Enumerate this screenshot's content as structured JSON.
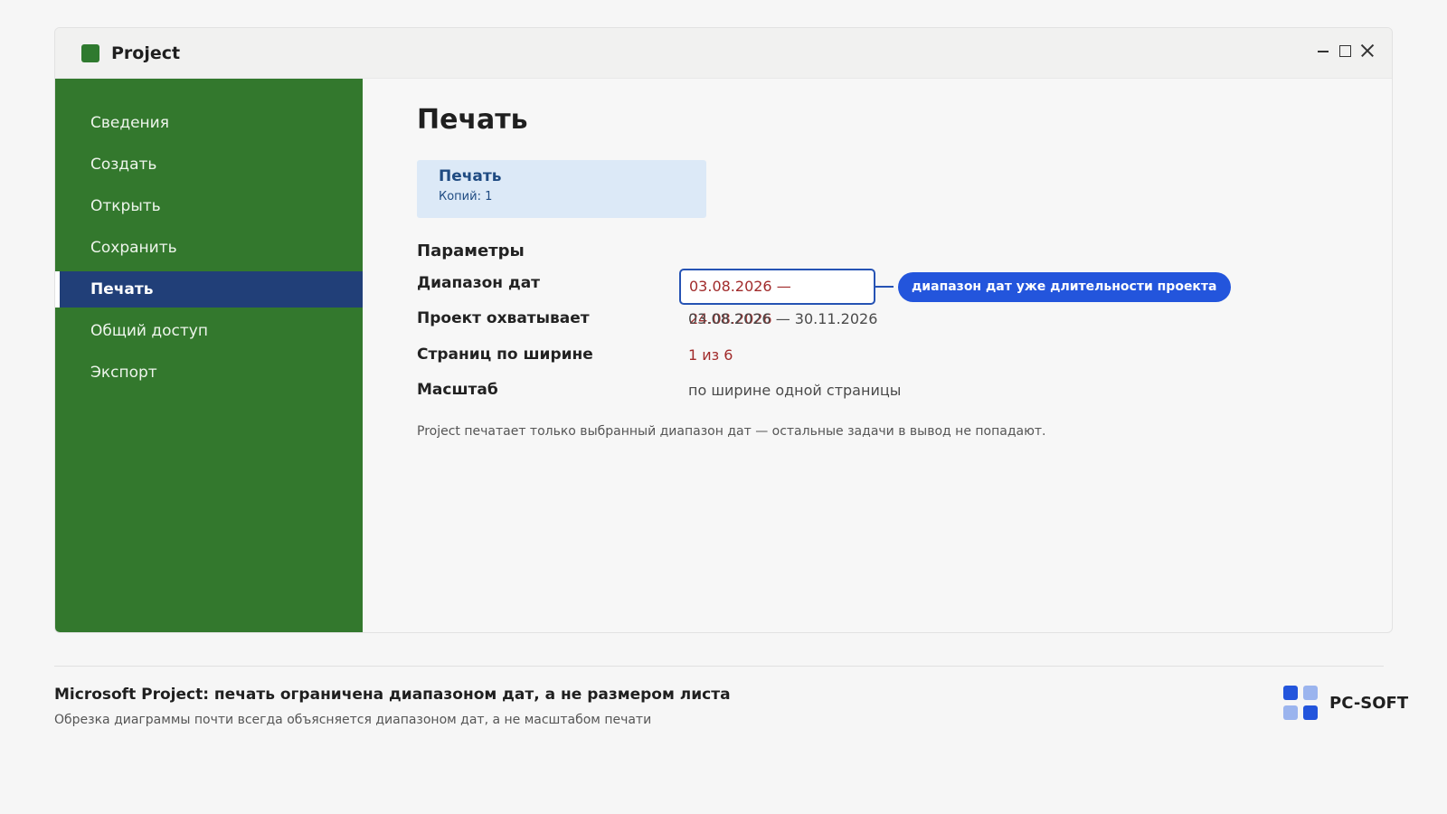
{
  "window": {
    "title": "Project",
    "icon": "project-app-icon",
    "accent": "#33782d"
  },
  "sidebar": {
    "items": [
      {
        "label": "Сведения"
      },
      {
        "label": "Создать"
      },
      {
        "label": "Открыть"
      },
      {
        "label": "Сохранить"
      },
      {
        "label": "Печать",
        "active": true
      },
      {
        "label": "Общий доступ"
      },
      {
        "label": "Экспорт"
      }
    ]
  },
  "main": {
    "title": "Печать",
    "print_button": {
      "label": "Печать",
      "copies": "Копий: 1"
    },
    "params_title": "Параметры",
    "rows": {
      "date_range": {
        "label": "Диапазон дат",
        "value": "03.08.2026 — 24.08.2026"
      },
      "project_span": {
        "label": "Проект охватывает",
        "value": "03.08.2026 — 30.11.2026"
      },
      "pages_wide": {
        "label": "Страниц по ширине",
        "value": "1 из 6"
      },
      "scale": {
        "label": "Масштаб",
        "value": "по ширине одной страницы"
      }
    },
    "callout": "диапазон дат уже длительности проекта",
    "note": "Project печатает только выбранный диапазон дат — остальные задачи в вывод не попадают."
  },
  "footer": {
    "title": "Microsoft Project: печать ограничена диапазоном дат, а не размером листа",
    "subtitle": "Обрезка диаграммы почти всегда объясняется диапазоном дат, а не масштабом печати",
    "brand": "PC-SOFT"
  },
  "colors": {
    "sidebar_bg": "#33782d",
    "active_nav": "#213f78",
    "print_card_bg": "#dce9f7",
    "warning_text": "#a12b2b",
    "callout_bg": "#2355dc"
  }
}
